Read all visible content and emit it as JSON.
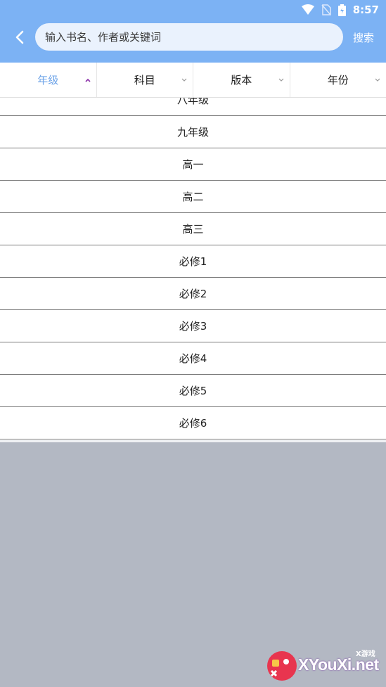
{
  "status_bar": {
    "time": "8:57"
  },
  "search": {
    "placeholder": "输入书名、作者或关键词",
    "button_label": "搜索"
  },
  "filters": [
    {
      "label": "年级",
      "active": true
    },
    {
      "label": "科目",
      "active": false
    },
    {
      "label": "版本",
      "active": false
    },
    {
      "label": "年份",
      "active": false
    }
  ],
  "grade_list": [
    "八年级",
    "九年级",
    "高一",
    "高二",
    "高三",
    "必修1",
    "必修2",
    "必修3",
    "必修4",
    "必修5",
    "必修6"
  ],
  "watermark": {
    "tag": "X游戏",
    "text": "XYouXi.net"
  },
  "colors": {
    "header": "#7cb2f4",
    "active_tab": "#6ea4e8",
    "overlay": "#b3b8c3"
  }
}
